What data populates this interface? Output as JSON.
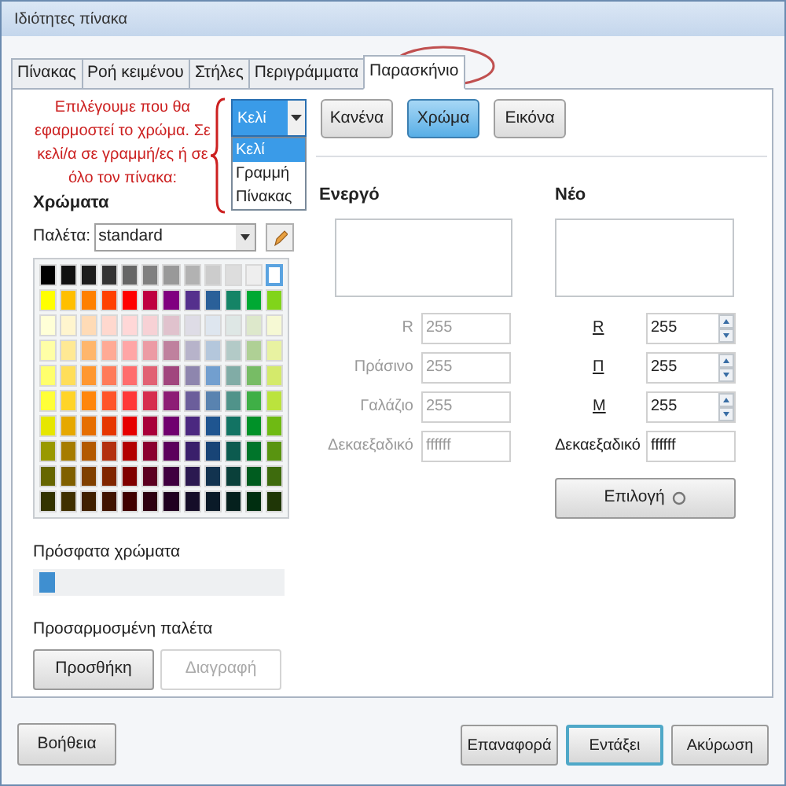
{
  "window": {
    "title": "Ιδιότητες πίνακα"
  },
  "tabs": [
    {
      "label": "Πίνακας",
      "selected": false
    },
    {
      "label": "Ροή κειμένου",
      "selected": false
    },
    {
      "label": "Στήλες",
      "selected": false
    },
    {
      "label": "Περιγράμματα",
      "selected": false
    },
    {
      "label": "Παρασκήνιο",
      "selected": true
    }
  ],
  "annotation": {
    "text": "Επιλέγουμε που θα εφαρμοστεί το χρώμα. Σε κελί/α σε γραμμή/ες ή σε όλο τον πίνακα:"
  },
  "apply_to": {
    "value": "Κελί",
    "options": [
      {
        "label": "Κελί",
        "selected": true
      },
      {
        "label": "Γραμμή",
        "selected": false
      },
      {
        "label": "Πίνακας",
        "selected": false
      }
    ]
  },
  "background_types": [
    {
      "label": "Κανένα",
      "selected": false
    },
    {
      "label": "Χρώμα",
      "selected": true
    },
    {
      "label": "Εικόνα",
      "selected": false
    }
  ],
  "colors": {
    "heading": "Χρώματα",
    "palette_label": "Παλέτα:",
    "palette_value": "standard",
    "swatches": [
      [
        {
          "color": "#000000",
          "selected": false
        },
        {
          "color": "#111111",
          "selected": false
        },
        {
          "color": "#1c1c1c",
          "selected": false
        },
        {
          "color": "#333333",
          "selected": false
        },
        {
          "color": "#666666",
          "selected": false
        },
        {
          "color": "#808080",
          "selected": false
        },
        {
          "color": "#999999",
          "selected": false
        },
        {
          "color": "#b2b2b2",
          "selected": false
        },
        {
          "color": "#cccccc",
          "selected": false
        },
        {
          "color": "#dddddd",
          "selected": false
        },
        {
          "color": "#eeeeee",
          "selected": false
        },
        {
          "color": "#ffffff",
          "selected": true
        }
      ],
      [
        {
          "color": "#ffff00",
          "selected": false
        },
        {
          "color": "#ffbf00",
          "selected": false
        },
        {
          "color": "#ff8000",
          "selected": false
        },
        {
          "color": "#ff4000",
          "selected": false
        },
        {
          "color": "#ff0000",
          "selected": false
        },
        {
          "color": "#bf0041",
          "selected": false
        },
        {
          "color": "#800080",
          "selected": false
        },
        {
          "color": "#55308d",
          "selected": false
        },
        {
          "color": "#2a6099",
          "selected": false
        },
        {
          "color": "#158466",
          "selected": false
        },
        {
          "color": "#00a933",
          "selected": false
        },
        {
          "color": "#81d41a",
          "selected": false
        }
      ],
      [
        {
          "color": "#ffffd7",
          "selected": false
        },
        {
          "color": "#fff5ce",
          "selected": false
        },
        {
          "color": "#ffdbb6",
          "selected": false
        },
        {
          "color": "#ffd8ce",
          "selected": false
        },
        {
          "color": "#ffd7d7",
          "selected": false
        },
        {
          "color": "#f7d1d5",
          "selected": false
        },
        {
          "color": "#e0c2cd",
          "selected": false
        },
        {
          "color": "#dedce6",
          "selected": false
        },
        {
          "color": "#dee6ef",
          "selected": false
        },
        {
          "color": "#dee7e5",
          "selected": false
        },
        {
          "color": "#dde8cb",
          "selected": false
        },
        {
          "color": "#f6f9d4",
          "selected": false
        }
      ],
      [
        {
          "color": "#ffffa6",
          "selected": false
        },
        {
          "color": "#ffe994",
          "selected": false
        },
        {
          "color": "#ffb66c",
          "selected": false
        },
        {
          "color": "#ffaa95",
          "selected": false
        },
        {
          "color": "#ffa6a6",
          "selected": false
        },
        {
          "color": "#ec9ba4",
          "selected": false
        },
        {
          "color": "#bf819e",
          "selected": false
        },
        {
          "color": "#b7b3ca",
          "selected": false
        },
        {
          "color": "#b4c7dc",
          "selected": false
        },
        {
          "color": "#b3cac7",
          "selected": false
        },
        {
          "color": "#afd095",
          "selected": false
        },
        {
          "color": "#e8f2a1",
          "selected": false
        }
      ],
      [
        {
          "color": "#ffff6d",
          "selected": false
        },
        {
          "color": "#ffde59",
          "selected": false
        },
        {
          "color": "#ff972f",
          "selected": false
        },
        {
          "color": "#ff7b59",
          "selected": false
        },
        {
          "color": "#ff6d6d",
          "selected": false
        },
        {
          "color": "#e16173",
          "selected": false
        },
        {
          "color": "#a1467e",
          "selected": false
        },
        {
          "color": "#8e86ae",
          "selected": false
        },
        {
          "color": "#729fcf",
          "selected": false
        },
        {
          "color": "#81aca6",
          "selected": false
        },
        {
          "color": "#77bc65",
          "selected": false
        },
        {
          "color": "#d4ea6b",
          "selected": false
        }
      ],
      [
        {
          "color": "#ffff38",
          "selected": false
        },
        {
          "color": "#ffd428",
          "selected": false
        },
        {
          "color": "#ff860d",
          "selected": false
        },
        {
          "color": "#ff5429",
          "selected": false
        },
        {
          "color": "#ff3838",
          "selected": false
        },
        {
          "color": "#d62e4e",
          "selected": false
        },
        {
          "color": "#8d1d75",
          "selected": false
        },
        {
          "color": "#6b5e9b",
          "selected": false
        },
        {
          "color": "#5983b0",
          "selected": false
        },
        {
          "color": "#50938a",
          "selected": false
        },
        {
          "color": "#3faf46",
          "selected": false
        },
        {
          "color": "#bbe33d",
          "selected": false
        }
      ],
      [
        {
          "color": "#e6e600",
          "selected": false
        },
        {
          "color": "#e6a800",
          "selected": false
        },
        {
          "color": "#e66e00",
          "selected": false
        },
        {
          "color": "#e63600",
          "selected": false
        },
        {
          "color": "#e60000",
          "selected": false
        },
        {
          "color": "#a8003a",
          "selected": false
        },
        {
          "color": "#70006f",
          "selected": false
        },
        {
          "color": "#4b2880",
          "selected": false
        },
        {
          "color": "#1f5590",
          "selected": false
        },
        {
          "color": "#127363",
          "selected": false
        },
        {
          "color": "#009128",
          "selected": false
        },
        {
          "color": "#6fba13",
          "selected": false
        }
      ],
      [
        {
          "color": "#999900",
          "selected": false
        },
        {
          "color": "#a67c00",
          "selected": false
        },
        {
          "color": "#b35900",
          "selected": false
        },
        {
          "color": "#b3300f",
          "selected": false
        },
        {
          "color": "#b30000",
          "selected": false
        },
        {
          "color": "#8b0030",
          "selected": false
        },
        {
          "color": "#5c005c",
          "selected": false
        },
        {
          "color": "#3a1f6b",
          "selected": false
        },
        {
          "color": "#184476",
          "selected": false
        },
        {
          "color": "#0c5b4f",
          "selected": false
        },
        {
          "color": "#00752a",
          "selected": false
        },
        {
          "color": "#599410",
          "selected": false
        }
      ],
      [
        {
          "color": "#666600",
          "selected": false
        },
        {
          "color": "#806000",
          "selected": false
        },
        {
          "color": "#804000",
          "selected": false
        },
        {
          "color": "#802600",
          "selected": false
        },
        {
          "color": "#800000",
          "selected": false
        },
        {
          "color": "#5c0021",
          "selected": false
        },
        {
          "color": "#400040",
          "selected": false
        },
        {
          "color": "#2b1950",
          "selected": false
        },
        {
          "color": "#12334f",
          "selected": false
        },
        {
          "color": "#0a403a",
          "selected": false
        },
        {
          "color": "#005c1f",
          "selected": false
        },
        {
          "color": "#3e6b0d",
          "selected": false
        }
      ],
      [
        {
          "color": "#333300",
          "selected": false
        },
        {
          "color": "#403000",
          "selected": false
        },
        {
          "color": "#402000",
          "selected": false
        },
        {
          "color": "#401300",
          "selected": false
        },
        {
          "color": "#400000",
          "selected": false
        },
        {
          "color": "#2e0010",
          "selected": false
        },
        {
          "color": "#200020",
          "selected": false
        },
        {
          "color": "#150d28",
          "selected": false
        },
        {
          "color": "#0a1a28",
          "selected": false
        },
        {
          "color": "#05201d",
          "selected": false
        },
        {
          "color": "#002e10",
          "selected": false
        },
        {
          "color": "#1f3606",
          "selected": false
        }
      ]
    ]
  },
  "recent": {
    "label": "Πρόσφατα χρώματα",
    "swatches": [
      {
        "color": "#3f8fd0"
      }
    ]
  },
  "custom_palette": {
    "label": "Προσαρμοσμένη παλέτα",
    "buttons": [
      {
        "label": "Προσθήκη",
        "disabled": false
      },
      {
        "label": "Διαγραφή",
        "disabled": true
      }
    ]
  },
  "current": {
    "heading": "Ενεργό",
    "fields": [
      {
        "label": "R",
        "value": "255",
        "disabled": true
      },
      {
        "label": "Πράσινο",
        "value": "255",
        "disabled": true
      },
      {
        "label": "Γαλάζιο",
        "value": "255",
        "disabled": true
      },
      {
        "label": "Δεκαεξαδικό",
        "value": "ffffff",
        "disabled": true
      }
    ]
  },
  "new": {
    "heading": "Νέο",
    "fields": [
      {
        "label": "R",
        "value": "255",
        "kind": "spin"
      },
      {
        "label": "Π",
        "value": "255",
        "kind": "spin"
      },
      {
        "label": "Μ",
        "value": "255",
        "kind": "spin"
      },
      {
        "label": "Δεκαεξαδικό",
        "value": "ffffff",
        "kind": "text"
      }
    ],
    "pick_button": "Επιλογή"
  },
  "footer": {
    "help": "Βοήθεια",
    "buttons": [
      {
        "label": "Επαναφορά",
        "default": false
      },
      {
        "label": "Εντάξει",
        "default": true
      },
      {
        "label": "Ακύρωση",
        "default": false
      }
    ]
  }
}
